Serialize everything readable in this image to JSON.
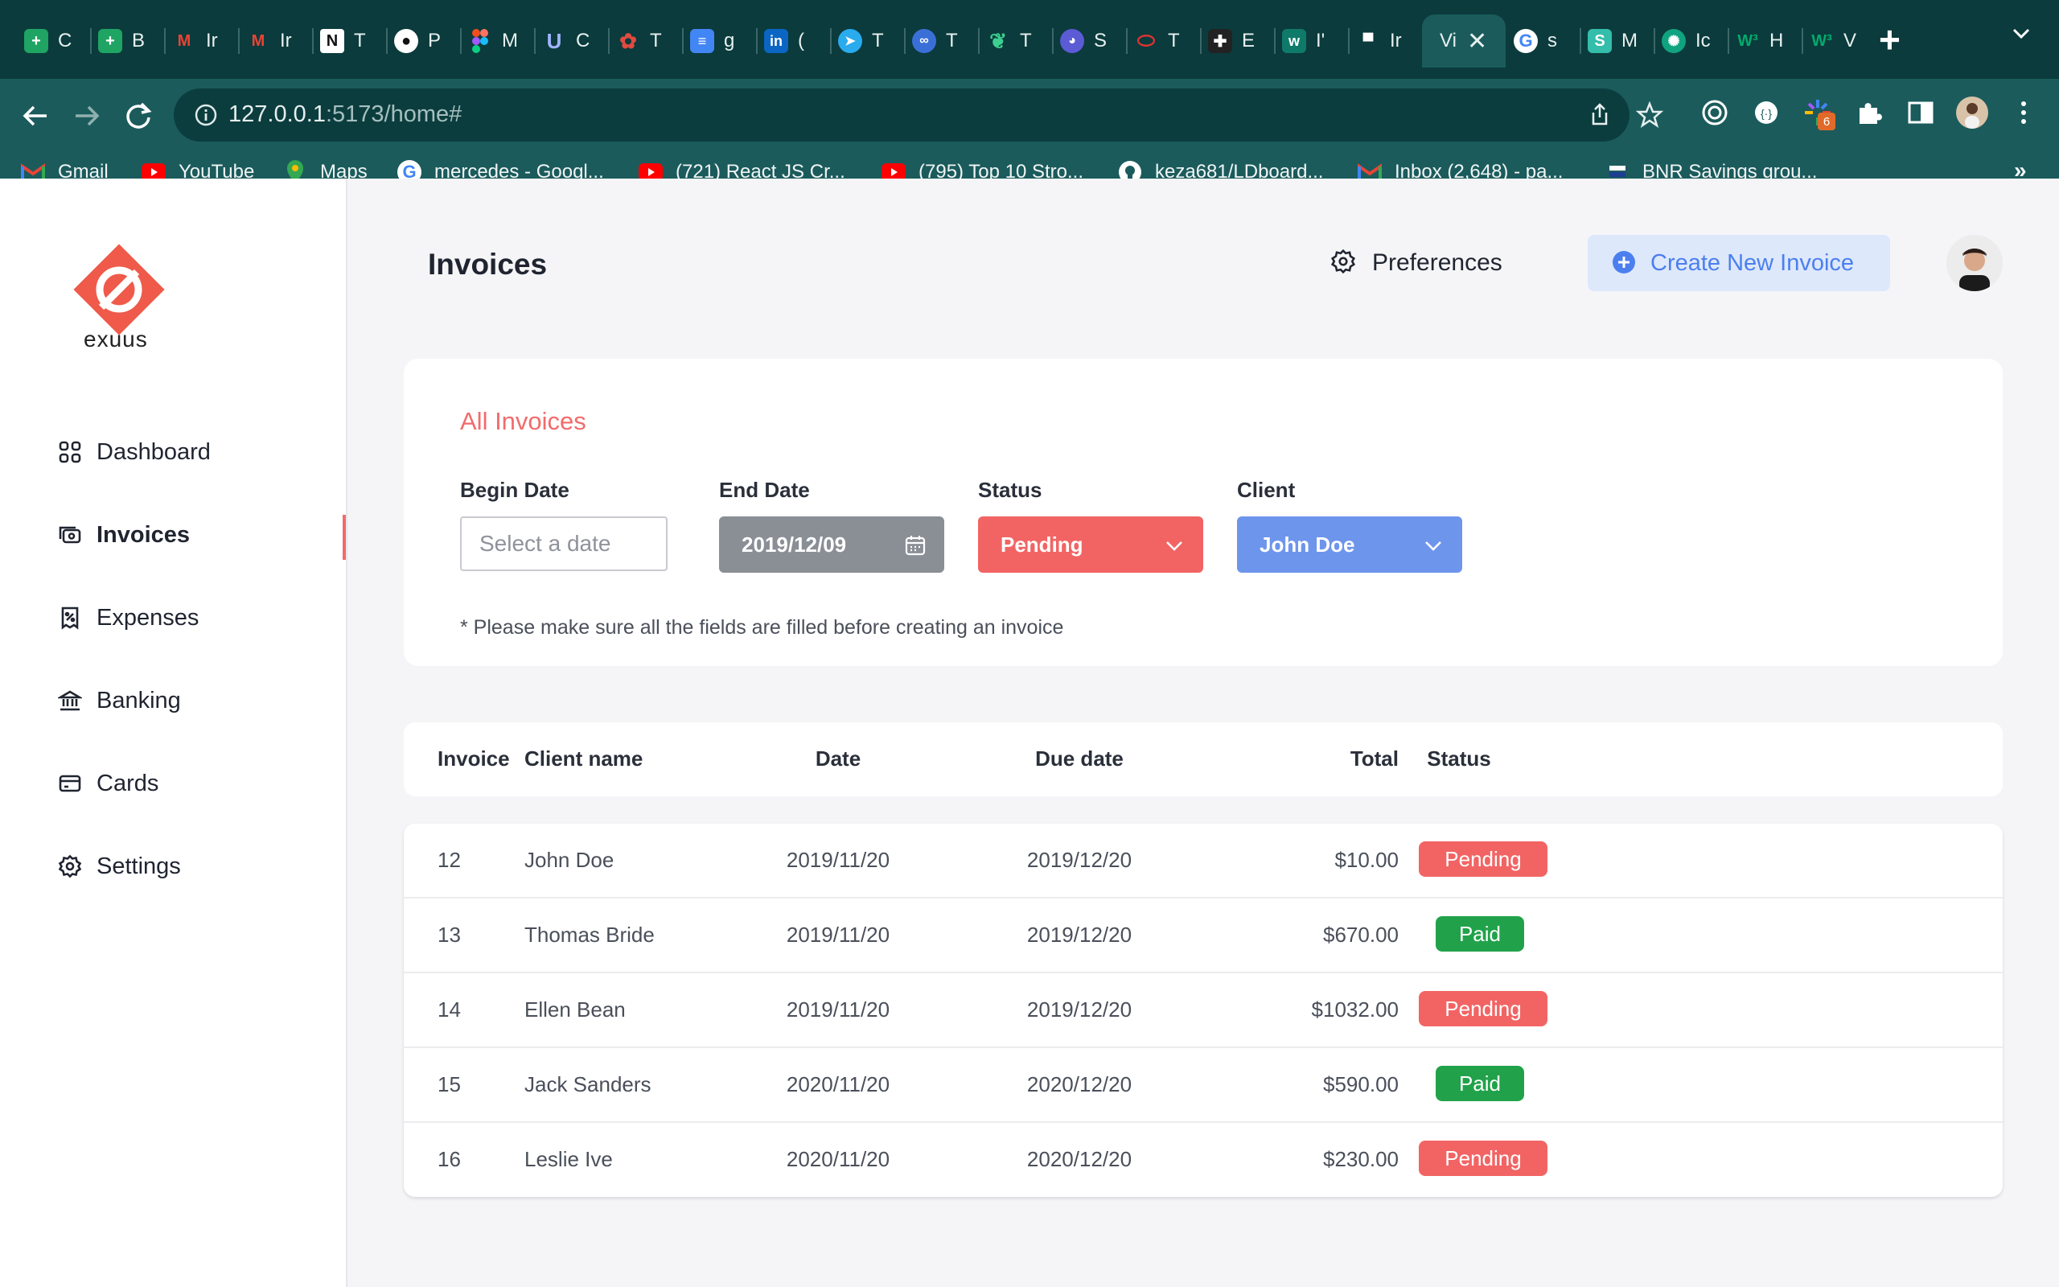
{
  "browser": {
    "tabs": [
      {
        "title": "C",
        "icon": "sheets-icon",
        "color": "#1fa463"
      },
      {
        "title": "B",
        "icon": "sheets-icon",
        "color": "#1fa463"
      },
      {
        "title": "Ir",
        "icon": "gmail-icon",
        "color": "#ea4335"
      },
      {
        "title": "Ir",
        "icon": "gmail-icon",
        "color": "#ea4335"
      },
      {
        "title": "T",
        "icon": "notion-icon",
        "color": "#ffffff"
      },
      {
        "title": "P",
        "icon": "github-icon",
        "color": "#ffffff"
      },
      {
        "title": "M",
        "icon": "figma-icon",
        "color": "#f24e1e"
      },
      {
        "title": "C",
        "icon": "udemy-icon",
        "color": "#a0b4ff"
      },
      {
        "title": "T",
        "icon": "openai-icon",
        "color": "#e04a3f"
      },
      {
        "title": "g",
        "icon": "docs-icon",
        "color": "#4285f4"
      },
      {
        "title": "(",
        "icon": "linkedin-icon",
        "color": "#0a66c2"
      },
      {
        "title": "T",
        "icon": "telegram-icon",
        "color": "#2aabee"
      },
      {
        "title": "T",
        "icon": "app-icon",
        "color": "#3b6fd8"
      },
      {
        "title": "T",
        "icon": "leaf-icon",
        "color": "#3ccf91"
      },
      {
        "title": "S",
        "icon": "ghost-icon",
        "color": "#5b5bd6"
      },
      {
        "title": "T",
        "icon": "ring-icon",
        "color": "#d33"
      },
      {
        "title": "E",
        "icon": "plus-app-icon",
        "color": "#222222"
      },
      {
        "title": "I'",
        "icon": "w-icon",
        "color": "#0f7a6a"
      },
      {
        "title": "Ir",
        "icon": "bnr-icon",
        "color": "#1c3f94"
      },
      {
        "title": "Vi",
        "icon": "vite-icon",
        "color": "#646cff",
        "active": true
      },
      {
        "title": "s",
        "icon": "google-icon",
        "color": "#ffffff"
      },
      {
        "title": "M",
        "icon": "s-icon",
        "color": "#33bdaa"
      },
      {
        "title": "Ic",
        "icon": "chatgpt-icon",
        "color": "#10a37f"
      },
      {
        "title": "H",
        "icon": "w3-icon",
        "color": "#04aa6d"
      },
      {
        "title": "V",
        "icon": "w3-icon",
        "color": "#04aa6d"
      }
    ],
    "url_host": "127.0.0.1",
    "url_path": ":5173/home#",
    "extension_badge": "6",
    "bookmarks": [
      {
        "label": "Gmail",
        "icon": "gmail-icon"
      },
      {
        "label": "YouTube",
        "icon": "youtube-icon"
      },
      {
        "label": "Maps",
        "icon": "maps-icon"
      },
      {
        "label": "mercedes - Googl...",
        "icon": "google-icon"
      },
      {
        "label": "(721) React JS Cr...",
        "icon": "youtube-icon"
      },
      {
        "label": "(795) Top 10 Stro...",
        "icon": "youtube-icon"
      },
      {
        "label": "keza681/LDboard...",
        "icon": "github-icon"
      },
      {
        "label": "Inbox (2,648) - pa...",
        "icon": "gmail-icon"
      },
      {
        "label": "BNR Savings grou...",
        "icon": "bnr-icon"
      }
    ]
  },
  "app": {
    "brand": "exuus",
    "nav": [
      {
        "label": "Dashboard",
        "icon": "grid-icon"
      },
      {
        "label": "Invoices",
        "icon": "invoice-icon",
        "active": true
      },
      {
        "label": "Expenses",
        "icon": "receipt-icon"
      },
      {
        "label": "Banking",
        "icon": "bank-icon"
      },
      {
        "label": "Cards",
        "icon": "card-icon"
      },
      {
        "label": "Settings",
        "icon": "gear-icon"
      }
    ],
    "header": {
      "title": "Invoices",
      "preferences": "Preferences",
      "create_button": "Create New Invoice"
    },
    "filters": {
      "section_title": "All Invoices",
      "begin_date_label": "Begin Date",
      "begin_date_placeholder": "Select a date",
      "end_date_label": "End Date",
      "end_date_value": "2019/12/09",
      "status_label": "Status",
      "status_value": "Pending",
      "client_label": "Client",
      "client_value": "John Doe",
      "note": "* Please make sure all the fields are filled before creating an invoice"
    },
    "table": {
      "columns": [
        "Invoice",
        "Client name",
        "Date",
        "Due date",
        "Total",
        "Status"
      ],
      "rows": [
        {
          "invoice": "12",
          "client": "John Doe",
          "date": "2019/11/20",
          "due": "2019/12/20",
          "total": "$10.00",
          "status": "Pending"
        },
        {
          "invoice": "13",
          "client": "Thomas Bride",
          "date": "2019/11/20",
          "due": "2019/12/20",
          "total": "$670.00",
          "status": "Paid"
        },
        {
          "invoice": "14",
          "client": "Ellen Bean",
          "date": "2019/11/20",
          "due": "2019/12/20",
          "total": "$1032.00",
          "status": "Pending"
        },
        {
          "invoice": "15",
          "client": "Jack Sanders",
          "date": "2020/11/20",
          "due": "2020/12/20",
          "total": "$590.00",
          "status": "Paid"
        },
        {
          "invoice": "16",
          "client": "Leslie Ive",
          "date": "2020/11/20",
          "due": "2020/12/20",
          "total": "$230.00",
          "status": "Pending"
        }
      ]
    },
    "colors": {
      "accent_red": "#f26464",
      "accent_blue": "#6d95ec",
      "paid_green": "#21a24a",
      "browser_dark": "#0b3b3c",
      "browser_toolbar": "#1b5b5c"
    }
  }
}
